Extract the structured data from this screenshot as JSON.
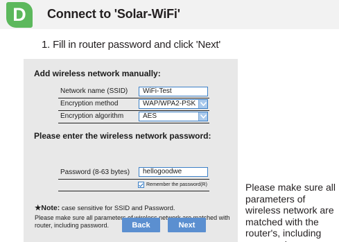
{
  "header": {
    "step_letter": "D",
    "title": "Connect to 'Solar-WiFi'",
    "accent_color": "#5cb85c"
  },
  "instruction": "1. Fill in router password and click 'Next'",
  "dialog": {
    "manual_title": "Add wireless network manually:",
    "fields": {
      "ssid_label": "Network name (SSID)",
      "ssid_value": "WiFi-Test",
      "encryption_label": "Encryption method",
      "encryption_value": "WAP/WPA2-PSK",
      "algorithm_label": "Encryption algorithm",
      "algorithm_value": "AES"
    },
    "password_title": "Please enter the wireless network password:",
    "password_label": "Password (8-63 bytes)",
    "password_value": "hellogoodwe",
    "remember_label": "Remember the password(R)",
    "remember_checked": true,
    "note_title": "★Note:",
    "note_text": " case sensitive for SSID and Password.",
    "note_body": "Please make sure all parameters of wireless network are matched with router, including password.",
    "back_label": "Back",
    "next_label": "Next"
  },
  "side_note": "Please make sure all parameters of wireless network are matched with the router's, including password.",
  "icons": {
    "dropdown": "chevron-down-icon",
    "checkbox": "checkmark-icon"
  }
}
